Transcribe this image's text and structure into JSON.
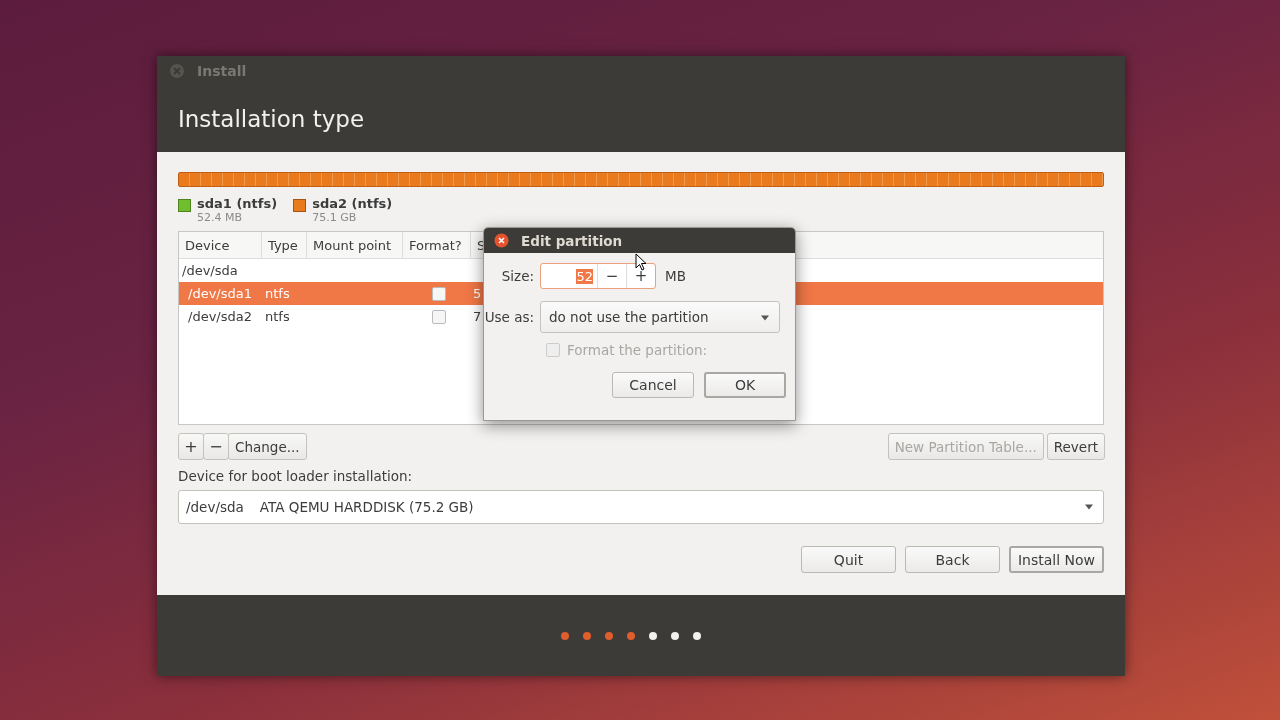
{
  "window": {
    "title": "Install",
    "heading": "Installation type"
  },
  "partitions_legend": [
    {
      "name": "sda1 (ntfs)",
      "size": "52.4 MB",
      "color": "#6fbe2e"
    },
    {
      "name": "sda2 (ntfs)",
      "size": "75.1 GB",
      "color": "#e97a1e"
    }
  ],
  "table": {
    "columns": [
      "Device",
      "Type",
      "Mount point",
      "Format?",
      "S"
    ],
    "rows": [
      {
        "cells": [
          "/dev/sda",
          "",
          "",
          "",
          ""
        ],
        "selected": false,
        "children": [
          {
            "cells": [
              "/dev/sda1",
              "ntfs",
              "",
              "",
              "5"
            ],
            "selected": true,
            "format": {
              "checked": false
            }
          },
          {
            "cells": [
              "/dev/sda2",
              "ntfs",
              "",
              "",
              "7"
            ],
            "selected": false,
            "format": {
              "checked": false
            }
          }
        ]
      }
    ]
  },
  "table_buttons": [
    {
      "label": "+",
      "kind": "icon"
    },
    {
      "label": "−",
      "kind": "icon"
    },
    {
      "label": "Change...",
      "kind": "text"
    }
  ],
  "table_right_buttons": [
    {
      "label": "New Partition Table...",
      "disabled": true
    },
    {
      "label": "Revert",
      "disabled": false
    }
  ],
  "boot_loader": {
    "label": "Device for boot loader installation:",
    "device": "/dev/sda",
    "description": "ATA QEMU HARDDISK (75.2 GB)"
  },
  "buttons": [
    {
      "label": "Quit",
      "default": false
    },
    {
      "label": "Back",
      "default": false
    },
    {
      "label": "Install Now",
      "default": true
    }
  ],
  "steps": [
    {
      "done": true
    },
    {
      "done": true
    },
    {
      "done": true
    },
    {
      "done": true
    },
    {
      "done": false
    },
    {
      "done": false
    },
    {
      "done": false
    }
  ],
  "dialog": {
    "title": "Edit partition",
    "size_label": "Size:",
    "size_value": "52",
    "size_unit": "MB",
    "minus": "−",
    "plus": "+",
    "use_as_label": "Use as:",
    "use_as_value": "do not use the partition",
    "format_label": "Format the partition:",
    "format_checked": false,
    "format_disabled": true,
    "cancel": "Cancel",
    "ok": "OK"
  }
}
